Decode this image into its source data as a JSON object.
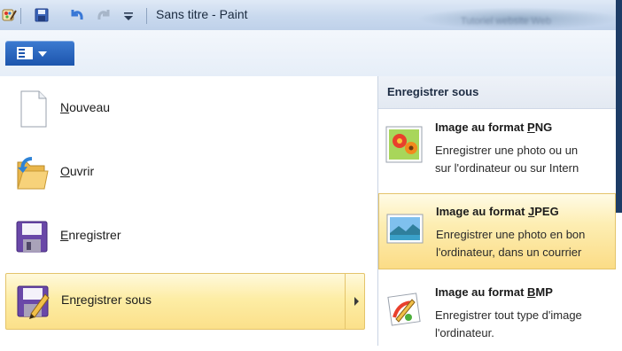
{
  "window": {
    "title": "Sans titre - Paint",
    "blurred_text": "Tutoriel website Web"
  },
  "quick_access": {
    "icons": [
      "paint-logo-icon",
      "save-icon",
      "undo-icon",
      "redo-icon",
      "customize-dropdown-icon"
    ]
  },
  "ribbon": {
    "menu_button_icon": "app-menu-icon"
  },
  "menu": {
    "items": [
      {
        "pre": "",
        "key": "N",
        "post": "ouveau",
        "icon": "new-document-icon"
      },
      {
        "pre": "",
        "key": "O",
        "post": "uvrir",
        "icon": "open-folder-icon"
      },
      {
        "pre": "",
        "key": "E",
        "post": "nregistrer",
        "icon": "save-disk-icon"
      },
      {
        "pre": "En",
        "key": "r",
        "post": "egistrer sous",
        "icon": "save-as-icon"
      }
    ]
  },
  "submenu": {
    "header": "Enregistrer sous",
    "items": [
      {
        "title_pre": "Image au format ",
        "title_key": "P",
        "title_post": "NG",
        "line1": "Enregistrer une photo ou un",
        "line2": "sur l'ordinateur ou sur Intern",
        "icon": "png-flower-icon"
      },
      {
        "title_pre": "Image au format ",
        "title_key": "J",
        "title_post": "PEG",
        "line1": "Enregistrer une photo en bon",
        "line2": "l'ordinateur, dans un courrier",
        "icon": "jpeg-landscape-icon"
      },
      {
        "title_pre": "Image au format ",
        "title_key": "B",
        "title_post": "MP",
        "line1": "Enregistrer tout type d'image",
        "line2": "l'ordinateur.",
        "icon": "bmp-paint-icon"
      }
    ]
  },
  "colors": {
    "accent": "#1c55ad",
    "hover": "#fdeda5",
    "title_bar": "#c9d9ee"
  }
}
